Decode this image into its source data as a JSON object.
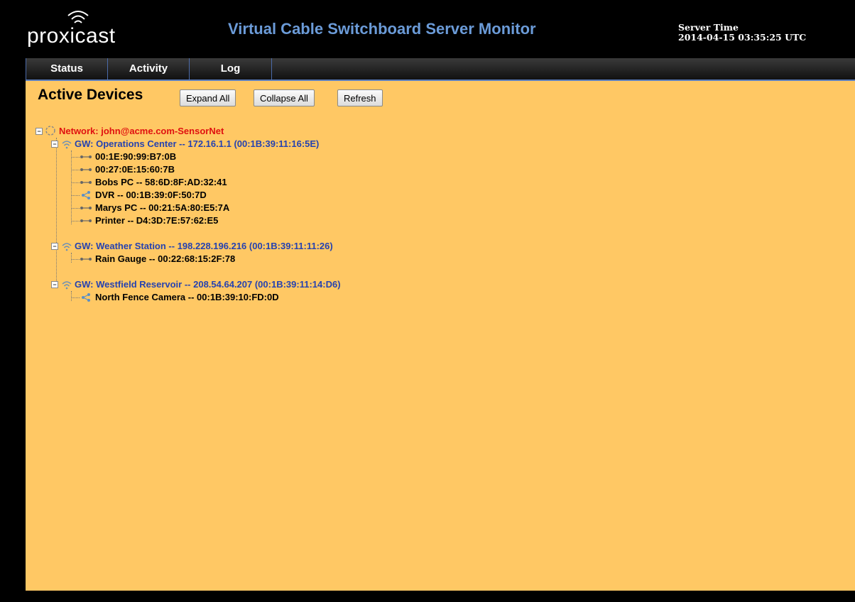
{
  "header": {
    "logo_text": "proxicast",
    "app_title": "Virtual Cable Switchboard Server Monitor",
    "server_time_label": "Server Time",
    "server_time_value": "2014-04-15 03:35:25 UTC"
  },
  "nav": {
    "tabs": [
      {
        "label": "Status"
      },
      {
        "label": "Activity"
      },
      {
        "label": "Log"
      }
    ]
  },
  "main": {
    "title": "Active Devices",
    "buttons": {
      "expand_all": "Expand All",
      "collapse_all": "Collapse All",
      "refresh": "Refresh"
    },
    "tree": {
      "network": {
        "label": "Network: john@acme.com-SensorNet",
        "icon": "network-icon"
      },
      "gateways": [
        {
          "label": "GW: Operations Center -- 172.16.1.1 (00:1B:39:11:16:5E)",
          "icon": "wifi-icon",
          "devices": [
            {
              "label": "00:1E:90:99:B7:0B",
              "icon": "cable-icon"
            },
            {
              "label": "00:27:0E:15:60:7B",
              "icon": "cable-icon"
            },
            {
              "label": "Bobs PC -- 58:6D:8F:AD:32:41",
              "icon": "cable-icon"
            },
            {
              "label": "DVR -- 00:1B:39:0F:50:7D",
              "icon": "share-icon"
            },
            {
              "label": "Marys PC -- 00:21:5A:80:E5:7A",
              "icon": "cable-icon"
            },
            {
              "label": "Printer -- D4:3D:7E:57:62:E5",
              "icon": "cable-icon"
            }
          ]
        },
        {
          "label": "GW: Weather Station -- 198.228.196.216 (00:1B:39:11:11:26)",
          "icon": "wifi-icon",
          "devices": [
            {
              "label": "Rain Gauge -- 00:22:68:15:2F:78",
              "icon": "cable-icon"
            }
          ]
        },
        {
          "label": "GW: Westfield Reservoir -- 208.54.64.207 (00:1B:39:11:14:D6)",
          "icon": "wifi-icon",
          "devices": [
            {
              "label": "North Fence Camera -- 00:1B:39:10:FD:0D",
              "icon": "share-icon"
            }
          ]
        }
      ]
    }
  },
  "colors": {
    "content_bg": "#ffc864",
    "network_text": "#e01010",
    "gateway_text": "#2542b0",
    "title_blue": "#6b9bd8"
  }
}
